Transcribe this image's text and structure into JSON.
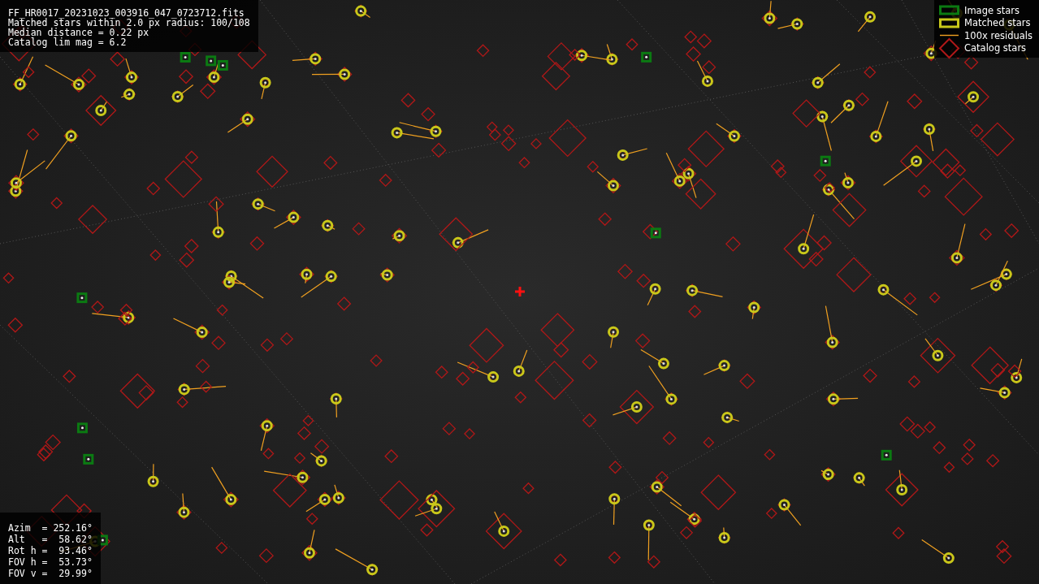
{
  "info_panel": {
    "lines": [
      "FF_HR0017_20231023_003916_047_0723712.fits",
      "Matched stars within 2.0 px radius: 100/108",
      "Median distance = 0.22 px",
      "Catalog lim mag = 6.2"
    ]
  },
  "legend": {
    "items": [
      {
        "kind": "image",
        "label": "Image stars",
        "color": "#0b7a12"
      },
      {
        "kind": "matched",
        "label": "Matched stars",
        "color": "#c8c81a"
      },
      {
        "kind": "residual",
        "label": "100x residuals",
        "color": "#f0a020"
      },
      {
        "kind": "catalog",
        "label": "Catalog stars",
        "color": "#b01818"
      }
    ]
  },
  "pointing_panel": {
    "lines": [
      "Azim  = 252.16°",
      "Alt   =  58.62°",
      "Rot h =  93.46°",
      "FOV h =  53.73°",
      "FOV v =  29.99°"
    ]
  }
}
